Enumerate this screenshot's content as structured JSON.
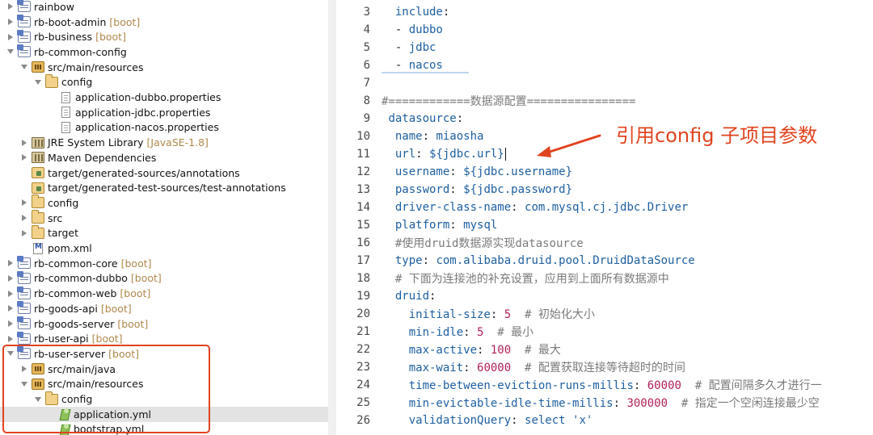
{
  "explorer": {
    "items": [
      {
        "label": "rainbow",
        "tag": "",
        "toggle": "closed",
        "icon": "project",
        "indent": 0
      },
      {
        "label": "rb-boot-admin",
        "tag": "[boot]",
        "toggle": "closed",
        "icon": "project",
        "indent": 0
      },
      {
        "label": "rb-business",
        "tag": "[boot]",
        "toggle": "closed",
        "icon": "project",
        "indent": 0
      },
      {
        "label": "rb-common-config",
        "tag": "",
        "toggle": "open",
        "icon": "project",
        "indent": 0
      },
      {
        "label": "src/main/resources",
        "tag": "",
        "toggle": "open",
        "icon": "srcfolder",
        "indent": 1
      },
      {
        "label": "config",
        "tag": "",
        "toggle": "open",
        "icon": "folder",
        "indent": 2
      },
      {
        "label": "application-dubbo.properties",
        "tag": "",
        "toggle": "none",
        "icon": "file",
        "indent": 3
      },
      {
        "label": "application-jdbc.properties",
        "tag": "",
        "toggle": "none",
        "icon": "file",
        "indent": 3
      },
      {
        "label": "application-nacos.properties",
        "tag": "",
        "toggle": "none",
        "icon": "file",
        "indent": 3
      },
      {
        "label": "JRE System Library",
        "tag": "[JavaSE-1.8]",
        "toggle": "closed",
        "icon": "library",
        "indent": 1
      },
      {
        "label": "Maven Dependencies",
        "tag": "",
        "toggle": "closed",
        "icon": "library",
        "indent": 1
      },
      {
        "label": "target/generated-sources/annotations",
        "tag": "",
        "toggle": "none",
        "icon": "pkgfolder",
        "indent": 1
      },
      {
        "label": "target/generated-test-sources/test-annotations",
        "tag": "",
        "toggle": "none",
        "icon": "pkgfolder",
        "indent": 1
      },
      {
        "label": "config",
        "tag": "",
        "toggle": "closed",
        "icon": "folder",
        "indent": 1
      },
      {
        "label": "src",
        "tag": "",
        "toggle": "closed",
        "icon": "folder",
        "indent": 1
      },
      {
        "label": "target",
        "tag": "",
        "toggle": "closed",
        "icon": "folder",
        "indent": 1
      },
      {
        "label": "pom.xml",
        "tag": "",
        "toggle": "none",
        "icon": "pom",
        "indent": 1
      },
      {
        "label": "rb-common-core",
        "tag": "[boot]",
        "toggle": "closed",
        "icon": "project",
        "indent": 0
      },
      {
        "label": "rb-common-dubbo",
        "tag": "[boot]",
        "toggle": "closed",
        "icon": "project",
        "indent": 0
      },
      {
        "label": "rb-common-web",
        "tag": "[boot]",
        "toggle": "closed",
        "icon": "project",
        "indent": 0
      },
      {
        "label": "rb-goods-api",
        "tag": "[boot]",
        "toggle": "closed",
        "icon": "project",
        "indent": 0
      },
      {
        "label": "rb-goods-server",
        "tag": "[boot]",
        "toggle": "closed",
        "icon": "project",
        "indent": 0
      },
      {
        "label": "rb-user-api",
        "tag": "[boot]",
        "toggle": "closed",
        "icon": "project",
        "indent": 0
      },
      {
        "label": "rb-user-server",
        "tag": "[boot]",
        "toggle": "open",
        "icon": "project",
        "indent": 0
      },
      {
        "label": "src/main/java",
        "tag": "",
        "toggle": "closed",
        "icon": "srcfolder",
        "indent": 1
      },
      {
        "label": "src/main/resources",
        "tag": "",
        "toggle": "open",
        "icon": "srcfolder",
        "indent": 1
      },
      {
        "label": "config",
        "tag": "",
        "toggle": "open",
        "icon": "folder",
        "indent": 2
      },
      {
        "label": "application.yml",
        "tag": "",
        "toggle": "none",
        "icon": "yml",
        "indent": 3,
        "selected": true
      },
      {
        "label": "bootstrap.yml",
        "tag": "",
        "toggle": "none",
        "icon": "yml",
        "indent": 3
      }
    ]
  },
  "editor": {
    "lines": [
      {
        "num": "3",
        "tokens": [
          {
            "t": "  ",
            "c": "p"
          },
          {
            "t": "include",
            "c": "k"
          },
          {
            "t": ":",
            "c": "p"
          }
        ]
      },
      {
        "num": "4",
        "tokens": [
          {
            "t": "  - ",
            "c": "p"
          },
          {
            "t": "dubbo",
            "c": "s"
          }
        ]
      },
      {
        "num": "5",
        "tokens": [
          {
            "t": "  - ",
            "c": "p"
          },
          {
            "t": "jdbc",
            "c": "s"
          }
        ]
      },
      {
        "num": "6",
        "tokens": [
          {
            "t": "  - ",
            "c": "p"
          },
          {
            "t": "nacos",
            "c": "s"
          }
        ]
      },
      {
        "num": "7",
        "tokens": []
      },
      {
        "num": "8",
        "tokens": [
          {
            "t": "#============数据源配置================",
            "c": "c"
          }
        ]
      },
      {
        "num": "9",
        "tokens": [
          {
            "t": " ",
            "c": "p"
          },
          {
            "t": "datasource",
            "c": "k"
          },
          {
            "t": ":",
            "c": "p"
          }
        ]
      },
      {
        "num": "10",
        "tokens": [
          {
            "t": "  ",
            "c": "p"
          },
          {
            "t": "name",
            "c": "k"
          },
          {
            "t": ": ",
            "c": "p"
          },
          {
            "t": "miaosha",
            "c": "s"
          }
        ]
      },
      {
        "num": "11",
        "tokens": [
          {
            "t": "  ",
            "c": "p"
          },
          {
            "t": "url",
            "c": "k"
          },
          {
            "t": ": ",
            "c": "p"
          },
          {
            "t": "${jdbc.url}",
            "c": "s"
          }
        ],
        "cursor": true
      },
      {
        "num": "12",
        "tokens": [
          {
            "t": "  ",
            "c": "p"
          },
          {
            "t": "username",
            "c": "k"
          },
          {
            "t": ": ",
            "c": "p"
          },
          {
            "t": "${jdbc.username}",
            "c": "s"
          }
        ]
      },
      {
        "num": "13",
        "tokens": [
          {
            "t": "  ",
            "c": "p"
          },
          {
            "t": "password",
            "c": "k"
          },
          {
            "t": ": ",
            "c": "p"
          },
          {
            "t": "${jdbc.password}",
            "c": "s"
          }
        ]
      },
      {
        "num": "14",
        "tokens": [
          {
            "t": "  ",
            "c": "p"
          },
          {
            "t": "driver-class-name",
            "c": "k"
          },
          {
            "t": ": ",
            "c": "p"
          },
          {
            "t": "com.mysql.cj.jdbc.Driver",
            "c": "s"
          }
        ]
      },
      {
        "num": "15",
        "tokens": [
          {
            "t": "  ",
            "c": "p"
          },
          {
            "t": "platform",
            "c": "k"
          },
          {
            "t": ": ",
            "c": "p"
          },
          {
            "t": "mysql",
            "c": "s"
          }
        ]
      },
      {
        "num": "16",
        "tokens": [
          {
            "t": "  #使用druid数据源实现datasource",
            "c": "c"
          }
        ]
      },
      {
        "num": "17",
        "tokens": [
          {
            "t": "  ",
            "c": "p"
          },
          {
            "t": "type",
            "c": "k"
          },
          {
            "t": ": ",
            "c": "p"
          },
          {
            "t": "com.alibaba.druid.pool.DruidDataSource",
            "c": "s"
          }
        ]
      },
      {
        "num": "18",
        "tokens": [
          {
            "t": "  # 下面为连接池的补充设置，应用到上面所有数据源中",
            "c": "c"
          }
        ]
      },
      {
        "num": "19",
        "tokens": [
          {
            "t": "  ",
            "c": "p"
          },
          {
            "t": "druid",
            "c": "k"
          },
          {
            "t": ":",
            "c": "p"
          }
        ]
      },
      {
        "num": "20",
        "tokens": [
          {
            "t": "    ",
            "c": "p"
          },
          {
            "t": "initial-size",
            "c": "k"
          },
          {
            "t": ": ",
            "c": "p"
          },
          {
            "t": "5",
            "c": "n"
          },
          {
            "t": "  # 初始化大小",
            "c": "c"
          }
        ]
      },
      {
        "num": "21",
        "tokens": [
          {
            "t": "    ",
            "c": "p"
          },
          {
            "t": "min-idle",
            "c": "k"
          },
          {
            "t": ": ",
            "c": "p"
          },
          {
            "t": "5",
            "c": "n"
          },
          {
            "t": "  # 最小",
            "c": "c"
          }
        ]
      },
      {
        "num": "22",
        "tokens": [
          {
            "t": "    ",
            "c": "p"
          },
          {
            "t": "max-active",
            "c": "k"
          },
          {
            "t": ": ",
            "c": "p"
          },
          {
            "t": "100",
            "c": "n"
          },
          {
            "t": "  # 最大",
            "c": "c"
          }
        ]
      },
      {
        "num": "23",
        "tokens": [
          {
            "t": "    ",
            "c": "p"
          },
          {
            "t": "max-wait",
            "c": "k"
          },
          {
            "t": ": ",
            "c": "p"
          },
          {
            "t": "60000",
            "c": "n"
          },
          {
            "t": "  # 配置获取连接等待超时的时间",
            "c": "c"
          }
        ]
      },
      {
        "num": "24",
        "tokens": [
          {
            "t": "    ",
            "c": "p"
          },
          {
            "t": "time-between-eviction-runs-millis",
            "c": "k"
          },
          {
            "t": ": ",
            "c": "p"
          },
          {
            "t": "60000",
            "c": "n"
          },
          {
            "t": "  # 配置间隔多久才进行一",
            "c": "c"
          }
        ]
      },
      {
        "num": "25",
        "tokens": [
          {
            "t": "    ",
            "c": "p"
          },
          {
            "t": "min-evictable-idle-time-millis",
            "c": "k"
          },
          {
            "t": ": ",
            "c": "p"
          },
          {
            "t": "300000",
            "c": "n"
          },
          {
            "t": "  # 指定一个空闲连接最少空",
            "c": "c"
          }
        ]
      },
      {
        "num": "26",
        "tokens": [
          {
            "t": "    ",
            "c": "p"
          },
          {
            "t": "validationQuery",
            "c": "k"
          },
          {
            "t": ": ",
            "c": "p"
          },
          {
            "t": "select 'x'",
            "c": "s"
          }
        ]
      }
    ]
  },
  "annotation": {
    "text": "引用config 子项目参数",
    "color": "#e0441f"
  },
  "colors": {
    "keyword": "#1e5fa0",
    "number": "#b0205a",
    "comment": "#7a7a7a",
    "tag": "#b0874a",
    "highlight_box": "#e0441f"
  }
}
